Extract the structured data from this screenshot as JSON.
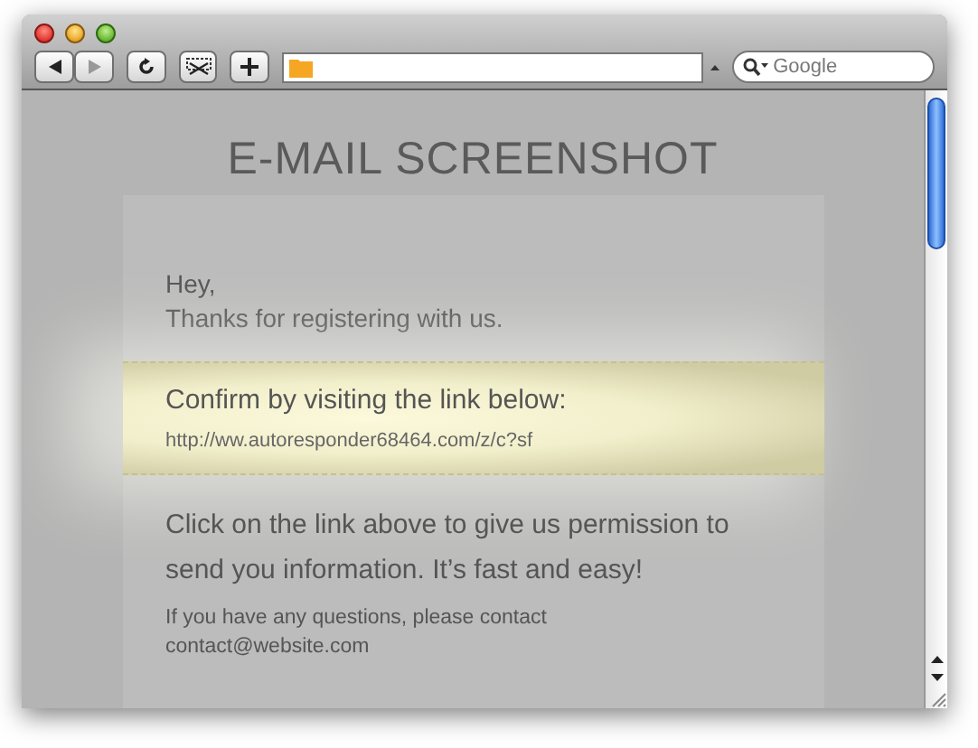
{
  "toolbar": {
    "search": {
      "placeholder": "Google"
    }
  },
  "email": {
    "title": "E-MAIL SCREENSHOT",
    "greeting": [
      "Hey,",
      "Thanks for registering with us."
    ],
    "highlight": {
      "heading": "Confirm by visiting the link below:",
      "link": "http://ww.autoresponder68464.com/z/c?sf"
    },
    "body": "Click on the link above to give us permission to send you information. It’s fast and easy!",
    "footer": [
      "If you have any questions, please contact",
      "contact@website.com"
    ]
  }
}
